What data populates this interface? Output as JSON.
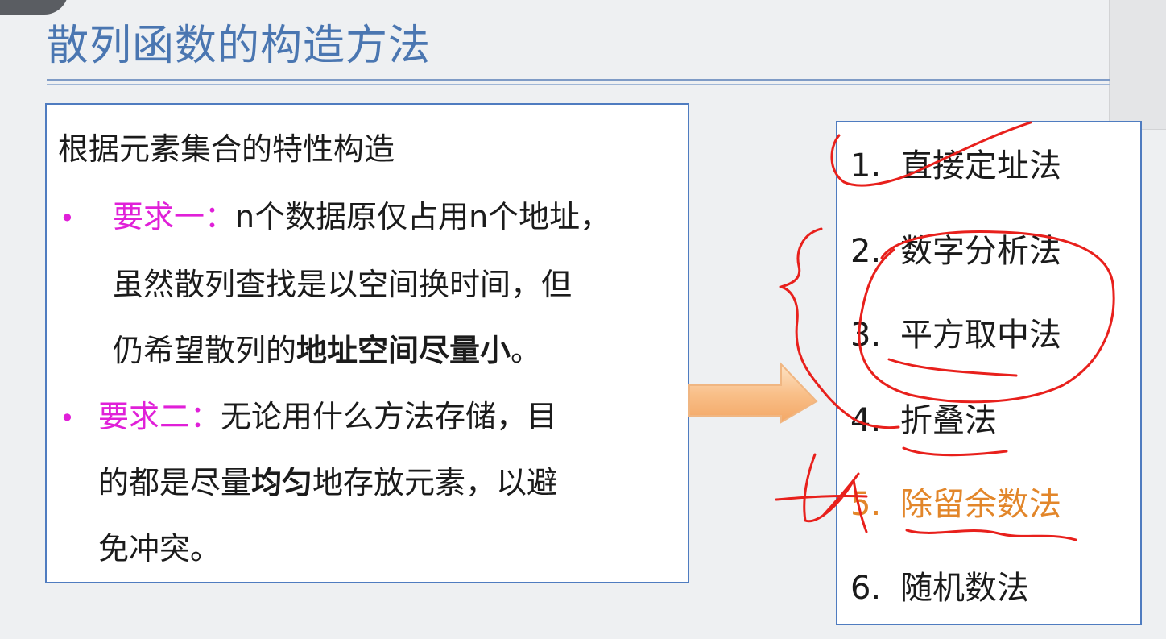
{
  "title": "散列函数的构造方法",
  "left_box": {
    "heading": "根据元素集合的特性构造",
    "req1_label": "要求一：",
    "req1_line1": "n个数据原仅占用n个地址，",
    "req1_line2": "虽然散列查找是以空间换时间，但",
    "req1_line3_normal": "仍希望散列的",
    "req1_line3_bold": "地址空间尽量小",
    "req1_line3_end": "。",
    "req2_label": "要求二：",
    "req2_line1": "无论用什么方法存储，目",
    "req2_line2_a": "的都是尽量",
    "req2_line2_bold": "均匀",
    "req2_line2_b": "地存放元素，以避",
    "req2_line3": "免冲突。",
    "bullet": "•"
  },
  "methods": [
    {
      "num": "1.",
      "label": "直接定址法"
    },
    {
      "num": "2.",
      "label": "数字分析法"
    },
    {
      "num": "3.",
      "label": "平方取中法"
    },
    {
      "num": "4.",
      "label": "折叠法"
    },
    {
      "num": "5.",
      "label": "除留余数法"
    },
    {
      "num": "6.",
      "label": "随机数法"
    }
  ],
  "colors": {
    "title": "#4a76b1",
    "requirement_label": "#e020d8",
    "highlight_method": "#e2862a",
    "annotation_ink": "#e8201c",
    "box_border": "#4f7cc0"
  }
}
